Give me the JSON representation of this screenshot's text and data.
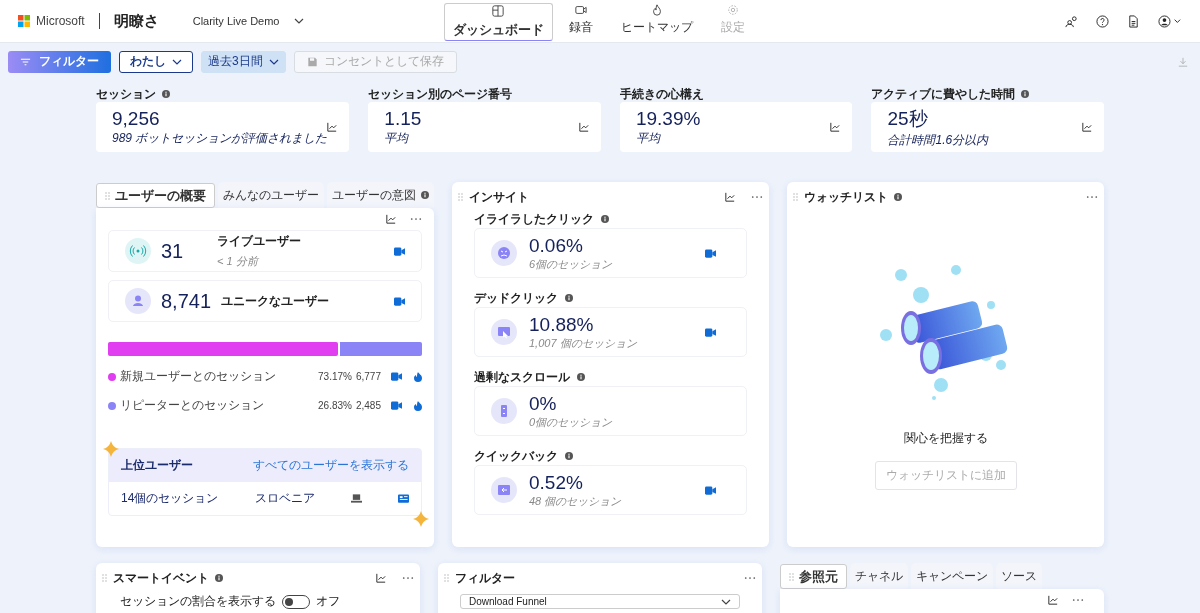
{
  "header": {
    "brand": "Microsoft",
    "app_name": "明瞭さ",
    "project": "Clarity Live Demo",
    "nav": [
      {
        "kind": "dashboard",
        "label": "ダッシュボード",
        "selected": true,
        "disabled": false
      },
      {
        "kind": "recordings",
        "label": "録音",
        "selected": false,
        "disabled": false
      },
      {
        "kind": "heatmaps",
        "label": "ヒートマップ",
        "selected": false,
        "disabled": false
      },
      {
        "kind": "settings",
        "label": "設定",
        "selected": false,
        "disabled": true
      }
    ]
  },
  "toolbar": {
    "filter_button": "フィルター",
    "user_dropdown": "わたし",
    "date_dropdown": "過去3日間",
    "save_button": {
      "label": "コンセントとして保存",
      "disabled": true
    }
  },
  "kpis": [
    {
      "label": "セッション",
      "info": true,
      "value": "9,256",
      "note": "989 ボットセッションが評価されました"
    },
    {
      "label": "セッション別のページ番号",
      "info": false,
      "value": "1.15",
      "note": "平均"
    },
    {
      "label": "手続きの心構え",
      "info": false,
      "value": "19.39%",
      "note": "平均"
    },
    {
      "label": "アクティブに費やした時間",
      "info": true,
      "value": "25秒",
      "note": "合計時間1.6分以内"
    }
  ],
  "user_panel": {
    "tabs": [
      {
        "label": "ユーザーの概要",
        "selected": true,
        "info": false
      },
      {
        "label": "みんなのユーザー",
        "selected": false,
        "info": false
      },
      {
        "label": "ユーザーの意図",
        "selected": false,
        "info": true
      }
    ],
    "stats": [
      {
        "kind": "live",
        "value": "31",
        "label": "ライブユーザー",
        "note": "< 1 分前"
      },
      {
        "kind": "unique",
        "value": "8,741",
        "label": "ユニークなユーザー"
      }
    ],
    "segments": [
      {
        "label": "新規ユーザーとのセッション",
        "color": "#e03ef0",
        "level": 0.7317,
        "percent": "73.17%",
        "count": "6,777"
      },
      {
        "label": "リピーターとのセッション",
        "color": "#8b84f6",
        "level": 0.2683,
        "percent": "26.83%",
        "count": "2,485"
      }
    ],
    "top_users": {
      "title": "上位ユーザー",
      "link": "すべてのユーザーを表示する",
      "rows": [
        {
          "sessions": "14個のセッション",
          "country": "スロベニア"
        }
      ]
    }
  },
  "insights": {
    "title": "インサイト",
    "items": [
      {
        "kind": "rage",
        "label": "イライラしたクリック",
        "value": "0.06%",
        "note": "6個のセッション",
        "has_recording": true
      },
      {
        "kind": "dead",
        "label": "デッドクリック",
        "value": "10.88%",
        "note": "1,007 個のセッション",
        "has_recording": true
      },
      {
        "kind": "scroll",
        "label": "過剰なスクロール",
        "value": "0%",
        "note": "0個のセッション",
        "has_recording": false
      },
      {
        "kind": "quickback",
        "label": "クイックバック",
        "value": "0.52%",
        "note": "48 個のセッション",
        "has_recording": true
      }
    ]
  },
  "watchlist": {
    "title": "ウォッチリスト",
    "message": "関心を把握する",
    "button": {
      "label": "ウォッチリストに追加",
      "disabled": true
    }
  },
  "smart_events": {
    "title": "スマートイベント",
    "toggle_label": "セッションの割合を表示する",
    "toggle": {
      "on": false,
      "label": "オフ"
    }
  },
  "filter_panel": {
    "title": "フィルター",
    "select_value": "Download Funnel"
  },
  "referrers": {
    "tabs": [
      {
        "label": "参照元",
        "selected": true
      },
      {
        "label": "チャネル",
        "selected": false
      },
      {
        "label": "キャンペーン",
        "selected": false
      },
      {
        "label": "ソース",
        "selected": false
      }
    ]
  }
}
